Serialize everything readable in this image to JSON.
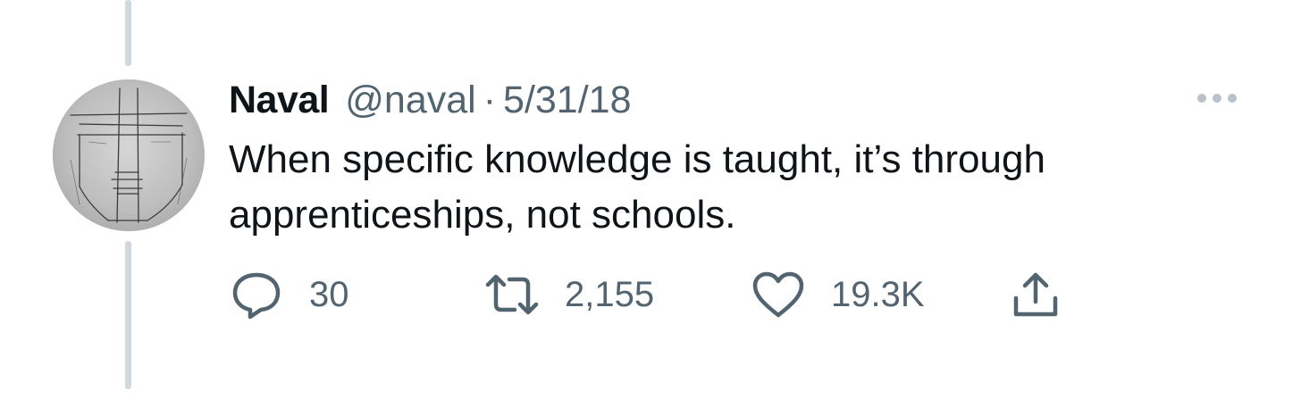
{
  "tweet": {
    "author": {
      "display_name": "Naval",
      "handle": "@naval"
    },
    "separator": "·",
    "date": "5/31/18",
    "text": "When specific knowledge is taught, it’s through apprenticeships, not schools."
  },
  "actions": {
    "reply": {
      "icon": "reply-icon",
      "count": "30"
    },
    "retweet": {
      "icon": "retweet-icon",
      "count": "2,155"
    },
    "like": {
      "icon": "heart-icon",
      "count": "19.3K"
    },
    "share": {
      "icon": "share-icon"
    }
  },
  "more_menu": {
    "icon": "more-icon"
  },
  "colors": {
    "text_primary": "#0f1419",
    "text_secondary": "#536471",
    "thread_line": "#cfd9de",
    "more_dots": "#b8c2ca",
    "background": "#ffffff"
  }
}
